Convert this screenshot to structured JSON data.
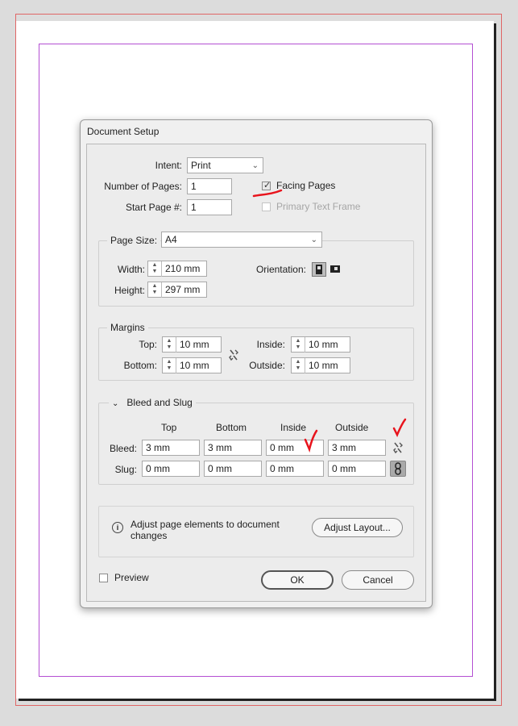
{
  "dialog": {
    "title": "Document Setup",
    "intent": {
      "label": "Intent:",
      "value": "Print"
    },
    "num_pages": {
      "label": "Number of Pages:",
      "value": "1"
    },
    "start_page": {
      "label": "Start Page #:",
      "value": "1"
    },
    "facing_pages": {
      "label": "Facing Pages",
      "checked": true
    },
    "primary_text_frame": {
      "label": "Primary Text Frame",
      "checked": false
    },
    "page_size": {
      "label": "Page Size:",
      "value": "A4",
      "width_label": "Width:",
      "width": "210 mm",
      "height_label": "Height:",
      "height": "297 mm",
      "orientation_label": "Orientation:"
    },
    "margins": {
      "label": "Margins",
      "top_label": "Top:",
      "top": "10 mm",
      "bottom_label": "Bottom:",
      "bottom": "10 mm",
      "inside_label": "Inside:",
      "inside": "10 mm",
      "outside_label": "Outside:",
      "outside": "10 mm"
    },
    "bleed_slug": {
      "label": "Bleed and Slug",
      "headers": [
        "Top",
        "Bottom",
        "Inside",
        "Outside"
      ],
      "bleed_label": "Bleed:",
      "bleed": [
        "3 mm",
        "3 mm",
        "0 mm",
        "3 mm"
      ],
      "slug_label": "Slug:",
      "slug": [
        "0 mm",
        "0 mm",
        "0 mm",
        "0 mm"
      ]
    },
    "adjust": {
      "text": "Adjust page elements to document changes",
      "line1": "Adjust page elements to document",
      "line2": "changes",
      "button": "Adjust Layout..."
    },
    "preview": {
      "label": "Preview",
      "checked": false
    },
    "ok": "OK",
    "cancel": "Cancel"
  },
  "colors": {
    "bleed_guide": "#e06666",
    "margin_guide": "#b44fd3",
    "annotation": "#e8141d"
  }
}
